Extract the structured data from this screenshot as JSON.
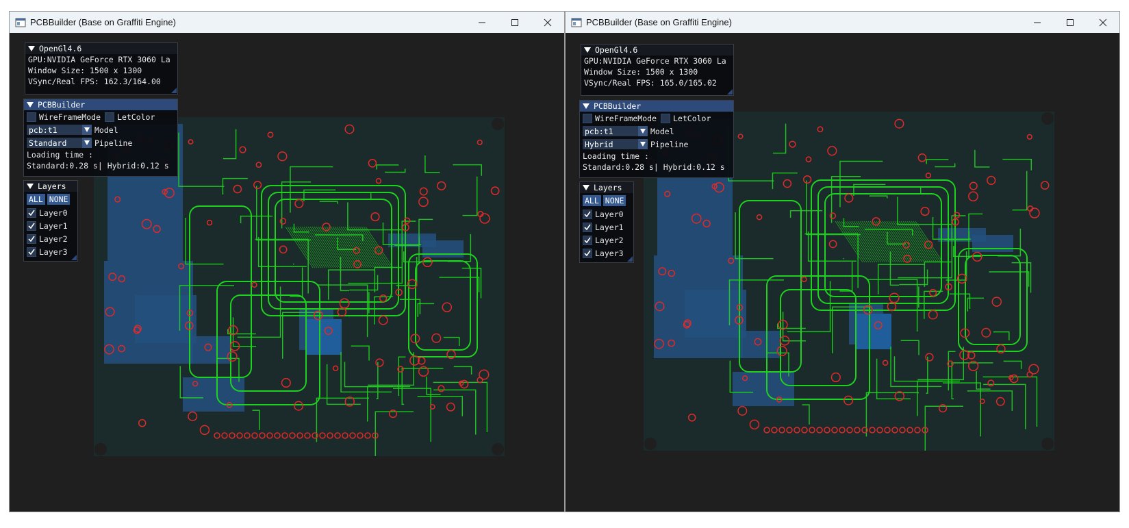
{
  "windows": [
    {
      "id": "left",
      "title": "PCBBuilder (Base on Graffiti Engine)",
      "opengl": {
        "header": "OpenGl4.6",
        "gpu": "GPU:NVIDIA GeForce RTX 3060 La",
        "window_size": "Window Size: 1500 x 1300",
        "fps": "VSync/Real FPS: 162.3/164.00"
      },
      "builder": {
        "header": "PCBBuilder",
        "wireframe_label": "WireFrameMode",
        "letcolor_label": "LetColor",
        "model_value": "pcb:t1",
        "model_label": "Model",
        "pipeline_value": "Standard",
        "pipeline_label": "Pipeline",
        "loading_label": "Loading time :",
        "loading_values": "Standard:0.28 s| Hybrid:0.12 s"
      },
      "layers": {
        "header": "Layers",
        "all_label": "ALL",
        "none_label": "NONE",
        "items": [
          "Layer0",
          "Layer1",
          "Layer2",
          "Layer3"
        ]
      }
    },
    {
      "id": "right",
      "title": "PCBBuilder (Base on Graffiti Engine)",
      "opengl": {
        "header": "OpenGl4.6",
        "gpu": "GPU:NVIDIA GeForce RTX 3060 La",
        "window_size": "Window Size: 1500 x 1300",
        "fps": "VSync/Real FPS: 165.0/165.02"
      },
      "builder": {
        "header": "PCBBuilder",
        "wireframe_label": "WireFrameMode",
        "letcolor_label": "LetColor",
        "model_value": "pcb:t1",
        "model_label": "Model",
        "pipeline_value": "Hybrid",
        "pipeline_label": "Pipeline",
        "loading_label": "Loading time :",
        "loading_values": "Standard:0.28 s| Hybrid:0.12 s"
      },
      "layers": {
        "header": "Layers",
        "all_label": "ALL",
        "none_label": "NONE",
        "items": [
          "Layer0",
          "Layer1",
          "Layer2",
          "Layer3"
        ]
      }
    }
  ],
  "colors": {
    "client_bg": "#1f1f1f",
    "board_bg": "#1b2a2a",
    "trace_green": "#1fd21f",
    "pad_red": "#e02a2a",
    "copper_blue": "#23507f",
    "panel_header_active": "#2d4a7a",
    "button_blue": "#355a91"
  }
}
